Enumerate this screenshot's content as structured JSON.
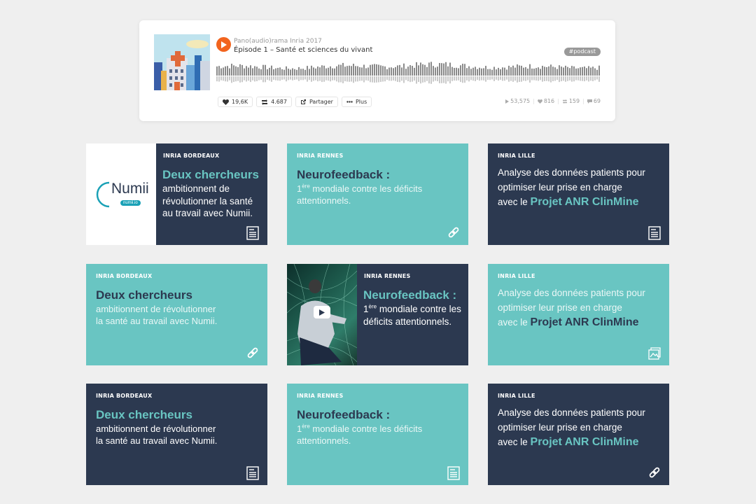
{
  "player": {
    "user": "Pano(audio)rama Inria 2017",
    "title": "Épisode 1 – Santé et sciences du vivant",
    "tag": "#podcast",
    "actions": {
      "like": "19,6K",
      "repost": "4.687",
      "share": "Partager",
      "more": "Plus"
    },
    "stats": {
      "plays": "53,575",
      "likes": "816",
      "reposts": "159",
      "comments": "69"
    }
  },
  "logo": {
    "name": "Numii",
    "url": "numii.io"
  },
  "texts": {
    "bordeaux_label": "INRIA BORDEAUX",
    "rennes_label": "INRIA RENNES",
    "lille_label": "INRIA LILLE",
    "bx_headline": "Deux chercheurs",
    "bx_body_short": "ambitionnent de révolutionner la santé au travail avec Numii.",
    "bx_body_l1": "ambitionnent de révolutionner",
    "bx_body_l2": "la santé au travail avec Numii.",
    "rn_headline": "Neurofeedback :",
    "rn_sup": "ère",
    "rn_num": "1",
    "rn_body": " mondiale contre les déficits attentionnels.",
    "li_l1": "Analyse des données patients pour",
    "li_l2": "optimiser leur prise en charge",
    "li_l3": "avec le ",
    "li_hl": "Projet ANR ClinMine"
  },
  "colors": {
    "dark": "#2c3950",
    "teal": "#69c5c2",
    "accent": "#f2641e"
  },
  "icons": [
    "play-icon",
    "heart-icon",
    "repost-icon",
    "share-icon",
    "more-icon",
    "article-icon",
    "link-icon",
    "gallery-icon",
    "video-play-icon"
  ]
}
